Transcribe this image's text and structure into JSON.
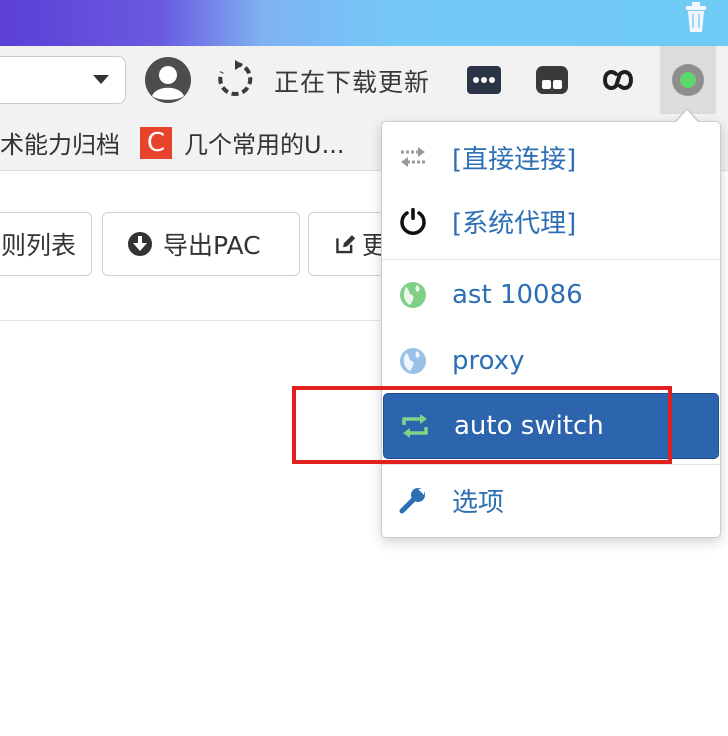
{
  "window": {
    "accent": "#74c9f7",
    "trash_icon": "trash-icon"
  },
  "toolbar": {
    "downloading_label": "正在下载更新",
    "avatar_icon": "avatar-icon",
    "refresh_icon": "refresh-icon",
    "extensions": [
      "more-dots-icon",
      "tab-icon",
      "link-icon",
      "proxy-status-icon"
    ],
    "proxy_status_color": "#5ddb6a"
  },
  "bookmarks": {
    "items": [
      {
        "label": "术能力归档"
      },
      {
        "icon_letter": "C",
        "label": "几个常用的U..."
      }
    ]
  },
  "page": {
    "buttons": {
      "list_label": "则列表",
      "export_label": "导出PAC",
      "edit_label": "更"
    }
  },
  "menu": {
    "items": [
      {
        "label": "[直接连接]",
        "icon": "direct-connect-icon"
      },
      {
        "label": "[系统代理]",
        "icon": "power-icon"
      },
      {
        "label": "ast 10086",
        "icon": "globe-icon-green"
      },
      {
        "label": "proxy",
        "icon": "globe-icon-blue"
      },
      {
        "label": "auto switch",
        "icon": "switch-icon",
        "active": true
      },
      {
        "label": "选项",
        "icon": "wrench-icon"
      }
    ],
    "active_color": "#2c64ad",
    "highlight_color": "#e0211f"
  }
}
